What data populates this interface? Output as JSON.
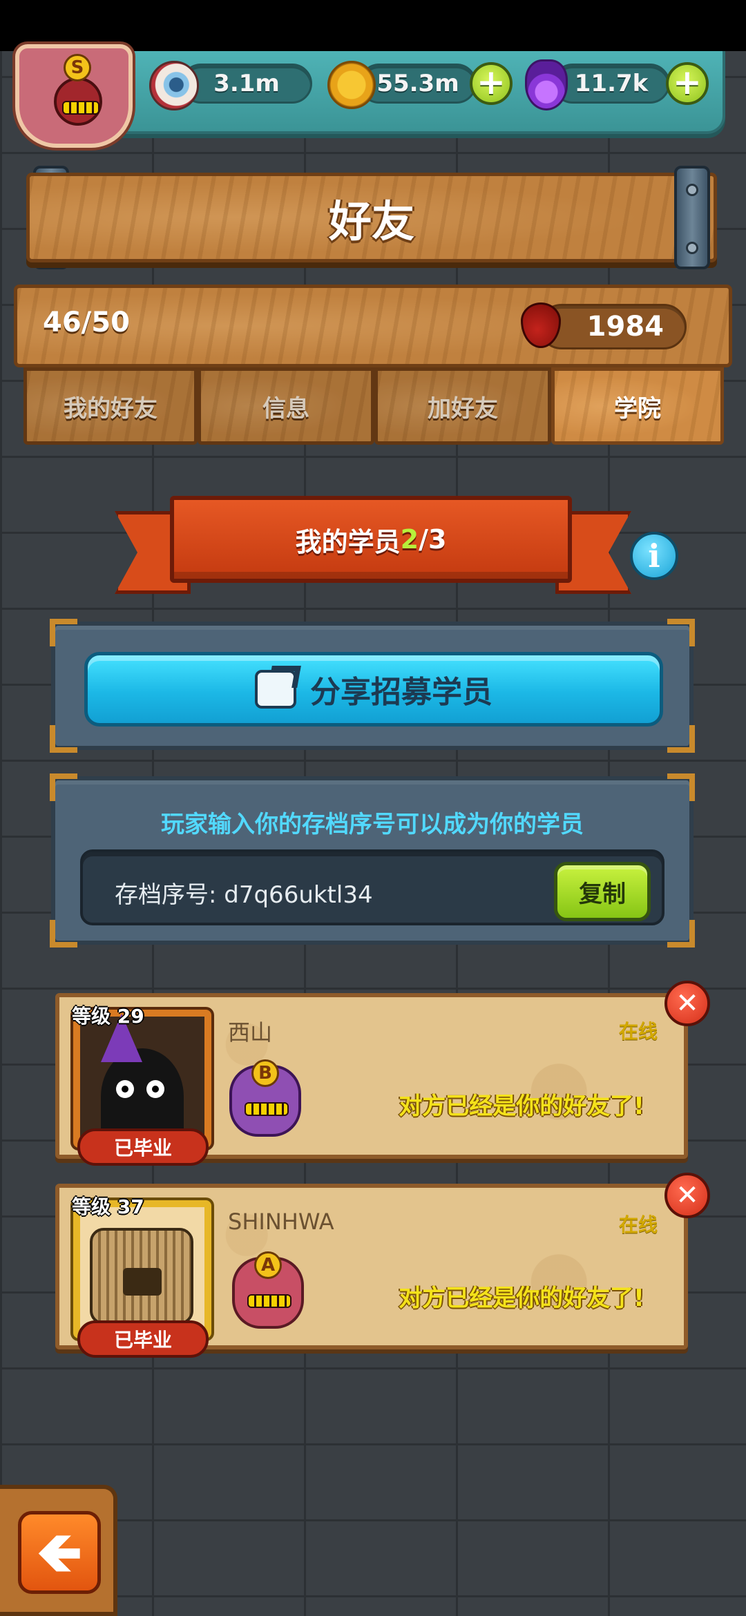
{
  "resources": {
    "eyes": "3.1m",
    "coins": "55.3m",
    "potions": "11.7k",
    "plus_label": "+"
  },
  "profile": {
    "grade": "S"
  },
  "page": {
    "title": "好友"
  },
  "stats": {
    "friends": "46/50",
    "blood": "1984"
  },
  "tabs": [
    {
      "label": "我的好友"
    },
    {
      "label": "信息"
    },
    {
      "label": "加好友"
    },
    {
      "label": "学院"
    }
  ],
  "academy": {
    "header_prefix": "我的学员 ",
    "current": "2",
    "separator_total": "/3",
    "info_label": "i",
    "share_label": "分享招募学员",
    "code_hint": "玩家输入你的存档序号可以成为你的学员",
    "code_text": "存档序号: d7q66uktl34",
    "copy_label": "复制"
  },
  "trainees": [
    {
      "level": "等级 29",
      "name": "西山",
      "status": "在线",
      "grade": "B",
      "badge": "已毕业",
      "message": "对方已经是你的好友了!"
    },
    {
      "level": "等级 37",
      "name": "SHINHWA",
      "status": "在线",
      "grade": "A",
      "badge": "已毕业",
      "message": "对方已经是你的好友了!"
    }
  ],
  "close_label": "✕",
  "back_label": "🡸"
}
